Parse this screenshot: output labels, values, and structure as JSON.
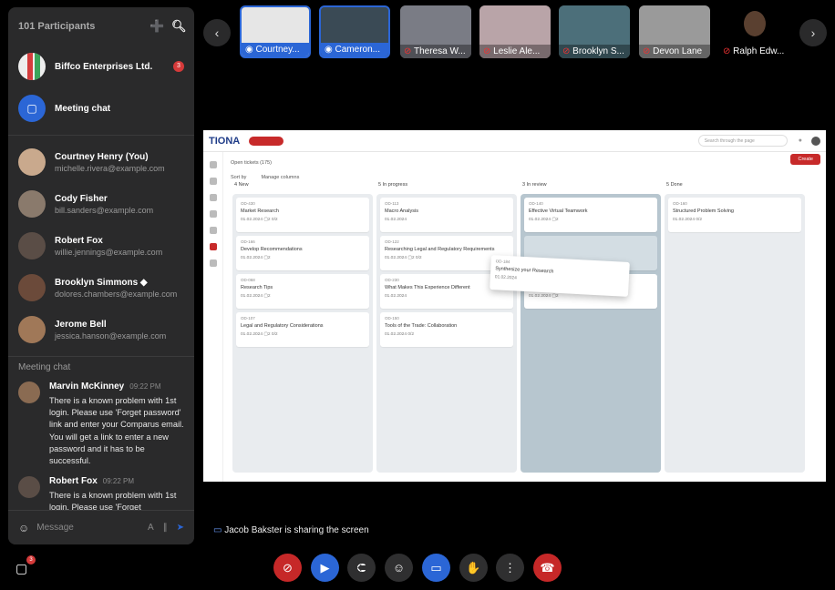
{
  "panel": {
    "participants_title": "101 Participants"
  },
  "pinned": [
    {
      "name": "Biffco Enterprises Ltd.",
      "badge": "3"
    },
    {
      "name": "Meeting chat"
    }
  ],
  "participants": [
    {
      "name": "Courtney Henry (You)",
      "email": "michelle.rivera@example.com"
    },
    {
      "name": "Cody Fisher",
      "email": "bill.sanders@example.com"
    },
    {
      "name": "Robert Fox",
      "email": "willie.jennings@example.com"
    },
    {
      "name": "Brooklyn Simmons",
      "email": "dolores.chambers@example.com"
    },
    {
      "name": "Jerome Bell",
      "email": "jessica.hanson@example.com"
    }
  ],
  "chat": {
    "section": "Meeting chat",
    "messages": [
      {
        "author": "Marvin McKinney",
        "time": "09:22 PM",
        "text": "There is a known problem with 1st login. Please use 'Forget password' link and enter your Comparus email. You will get a link to enter a new password and it has to be successful."
      },
      {
        "author": "Robert Fox",
        "time": "09:22 PM",
        "text": "There is a known problem with 1st login. Please use 'Forget"
      }
    ],
    "placeholder": "Message"
  },
  "tiles": [
    "Courtney...",
    "Cameron...",
    "Theresa W...",
    "Leslie Ale...",
    "Brooklyn S...",
    "Devon Lane",
    "Ralph Edw..."
  ],
  "app": {
    "logo": "TIONA",
    "search": "Search through the page",
    "filter": "Open tickets (175)",
    "sort": "Sort by",
    "manage": "Manage columns",
    "create": "Create",
    "columns": [
      {
        "title": "4 New",
        "cards": [
          {
            "id": "OD-430",
            "title": "Market Research",
            "date": "01.02.2024",
            "c": "2",
            "s": "0/2"
          },
          {
            "id": "OD-166",
            "title": "Develop Recommendations",
            "date": "01.02.2024",
            "c": "2",
            "tags": [
              "Mobile",
              "Need UI/UX",
              "Login",
              "+3"
            ]
          },
          {
            "id": "OD-068",
            "title": "Research Tips",
            "date": "01.02.2024",
            "c": "2"
          },
          {
            "id": "OD-107",
            "title": "Legal and Regulatory Considerations",
            "date": "01.02.2024",
            "c": "2",
            "s": "0/2"
          }
        ]
      },
      {
        "title": "5 In progress",
        "cards": [
          {
            "id": "OD-113",
            "title": "Macro Analysis",
            "date": "01.02.2024",
            "tags": [
              "Mobile",
              "Need UI/UX",
              "Login",
              "+3"
            ]
          },
          {
            "id": "OD-122",
            "title": "Researching Legal and Regulatory Requirements",
            "date": "01.02.2024",
            "c": "2",
            "s": "0/2",
            "tags": [
              "Mobile",
              "Need UI/UX",
              "Login",
              "+3"
            ]
          },
          {
            "id": "OD-230",
            "title": "What Makes This Experience Different",
            "date": "01.02.2024",
            "tags": [
              "Mobile",
              "Need UI/UX",
              "Login",
              "+3"
            ]
          },
          {
            "id": "OD-150",
            "title": "Tools of the Trade: Collaboration",
            "date": "01.02.2024",
            "s": "0/2"
          }
        ]
      },
      {
        "title": "3 In review",
        "cards": [
          {
            "id": "OD-140",
            "title": "Effective Virtual Teamwork",
            "date": "01.02.2024",
            "c": "2"
          },
          {
            "id": "",
            "title": "",
            "date": ""
          },
          {
            "id": "OD-",
            "title": "Effective Virtual Teamwork",
            "date": "01.02.2024",
            "c": "2"
          }
        ]
      },
      {
        "title": "5 Done",
        "cards": [
          {
            "id": "OD-160",
            "title": "Structured Problem Solving",
            "date": "01.02.2024",
            "s": "0/2",
            "tags": [
              "Mobile",
              "Need UI/UX",
              "Login",
              "+3"
            ]
          }
        ]
      }
    ],
    "dragging": {
      "id": "OD-184",
      "title": "Synthesize your Research",
      "date": "01.02.2024"
    }
  },
  "sharing": "Jacob Bakster is sharing the screen",
  "chat_badge": "3"
}
